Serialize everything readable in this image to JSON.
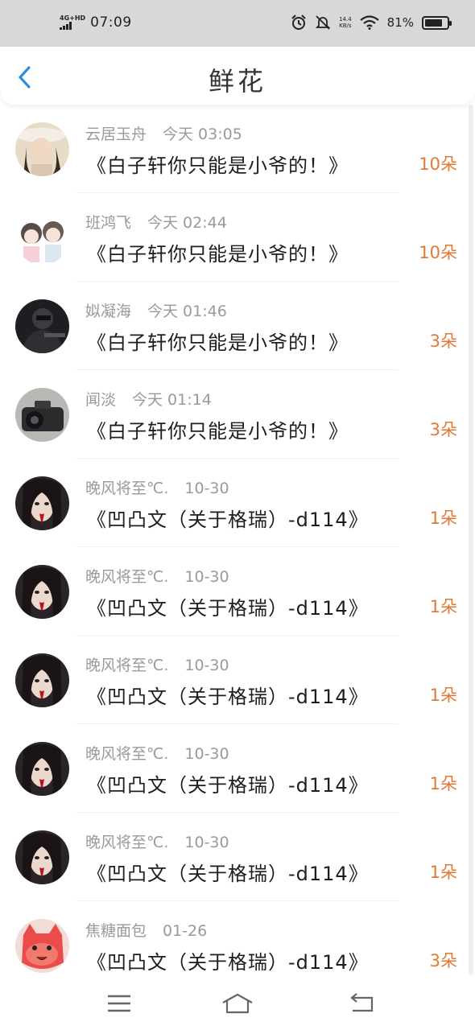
{
  "status_bar": {
    "network": "4G+HD",
    "time": "07:09",
    "speed_top": "14.4",
    "speed_unit": "KB/s",
    "battery": "81%"
  },
  "header": {
    "title": "鲜花"
  },
  "colors": {
    "accent_blue": "#2a8fe0",
    "count_orange": "#e07a35"
  },
  "items": [
    {
      "name": "云居玉舟",
      "time": "今天 03:05",
      "title": "《白子轩你只能是小爷的！》",
      "count": "10朵"
    },
    {
      "name": "班鸿飞",
      "time": "今天 02:44",
      "title": "《白子轩你只能是小爷的！》",
      "count": "10朵"
    },
    {
      "name": "姒凝海",
      "time": "今天 01:46",
      "title": "《白子轩你只能是小爷的！》",
      "count": "3朵"
    },
    {
      "name": "闻淡",
      "time": "今天 01:14",
      "title": "《白子轩你只能是小爷的！》",
      "count": "3朵"
    },
    {
      "name": "晚风将至℃.",
      "time": "10-30",
      "title": "《凹凸文（关于格瑞）-d114》",
      "count": "1朵"
    },
    {
      "name": "晚风将至℃.",
      "time": "10-30",
      "title": "《凹凸文（关于格瑞）-d114》",
      "count": "1朵"
    },
    {
      "name": "晚风将至℃.",
      "time": "10-30",
      "title": "《凹凸文（关于格瑞）-d114》",
      "count": "1朵"
    },
    {
      "name": "晚风将至℃.",
      "time": "10-30",
      "title": "《凹凸文（关于格瑞）-d114》",
      "count": "1朵"
    },
    {
      "name": "晚风将至℃.",
      "time": "10-30",
      "title": "《凹凸文（关于格瑞）-d114》",
      "count": "1朵"
    },
    {
      "name": "焦糖面包",
      "time": "01-26",
      "title": "《凹凸文（关于格瑞）-d114》",
      "count": "3朵"
    }
  ]
}
